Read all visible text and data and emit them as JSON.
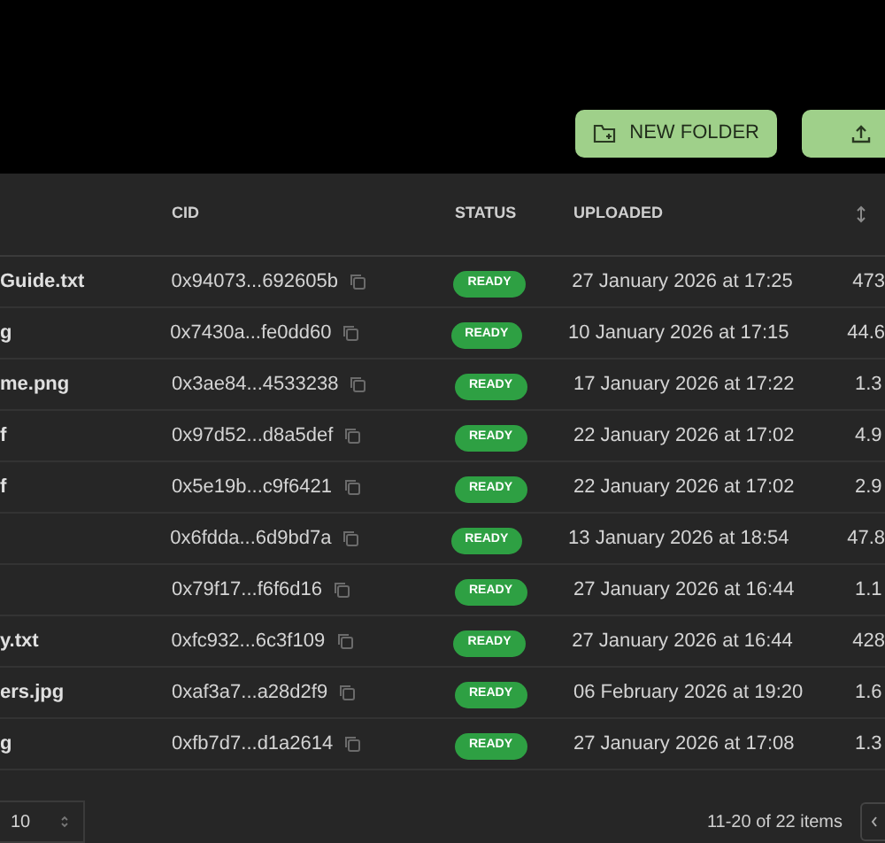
{
  "toolbar": {
    "new_folder_button": "NEW FOLDER"
  },
  "table": {
    "columns": [
      "CID",
      "STATUS",
      "UPLOADED"
    ],
    "rows": [
      {
        "name": "Guide.txt",
        "cid": "0x94073...692605b",
        "status": "READY",
        "uploaded": "27 January 2026 at 17:25",
        "size": "473"
      },
      {
        "name": "g",
        "cid": "0x7430a...fe0dd60",
        "status": "READY",
        "uploaded": "10 January 2026 at 17:15",
        "size": "44.6"
      },
      {
        "name": "me.png",
        "cid": "0x3ae84...4533238",
        "status": "READY",
        "uploaded": "17 January 2026 at 17:22",
        "size": "1.3"
      },
      {
        "name": "f",
        "cid": "0x97d52...d8a5def",
        "status": "READY",
        "uploaded": "22 January 2026 at 17:02",
        "size": "4.9"
      },
      {
        "name": "f",
        "cid": "0x5e19b...c9f6421",
        "status": "READY",
        "uploaded": "22 January 2026 at 17:02",
        "size": "2.9"
      },
      {
        "cid": "0x6fdda...6d9bd7a",
        "status": "READY",
        "uploaded": "13 January 2026 at 18:54",
        "size": "47.8"
      },
      {
        "cid": "0x79f17...f6f6d16",
        "status": "READY",
        "uploaded": "27 January 2026 at 16:44",
        "size": "1.1"
      },
      {
        "name": "y.txt",
        "cid": "0xfc932...6c3f109",
        "status": "READY",
        "uploaded": "27 January 2026 at 16:44",
        "size": "428"
      },
      {
        "name": "ers.jpg",
        "cid": "0xaf3a7...a28d2f9",
        "status": "READY",
        "uploaded": "06 February 2026 at 19:20",
        "size": "1.6"
      },
      {
        "name": "g",
        "cid": "0xfb7d7...d1a2614",
        "status": "READY",
        "uploaded": "27 January 2026 at 17:08",
        "size": "1.3"
      }
    ]
  },
  "footer": {
    "page_size": "10",
    "range": "11-20 of 22 items"
  }
}
